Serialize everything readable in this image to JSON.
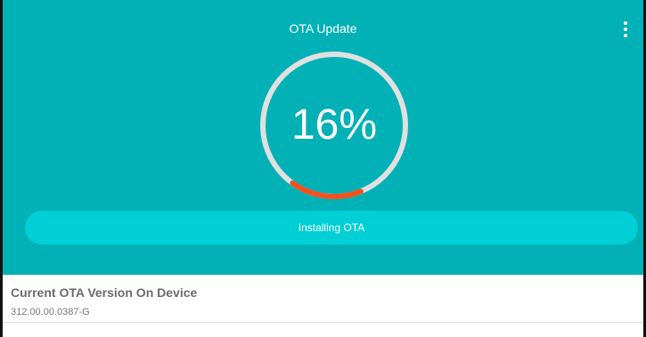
{
  "app": {
    "title": "OTA Update",
    "menu_icon": "more-vert-icon"
  },
  "progress": {
    "percent_label": "16%",
    "value": 0.16,
    "track_color": "#e0e0e0",
    "fill_color": "#f4511e"
  },
  "action": {
    "label": "Installing OTA"
  },
  "info": {
    "label": "Current OTA Version On Device",
    "value": "312.00.00.0387-G"
  },
  "colors": {
    "header_background": "#02b1b5",
    "button_background": "#00cfd6"
  }
}
